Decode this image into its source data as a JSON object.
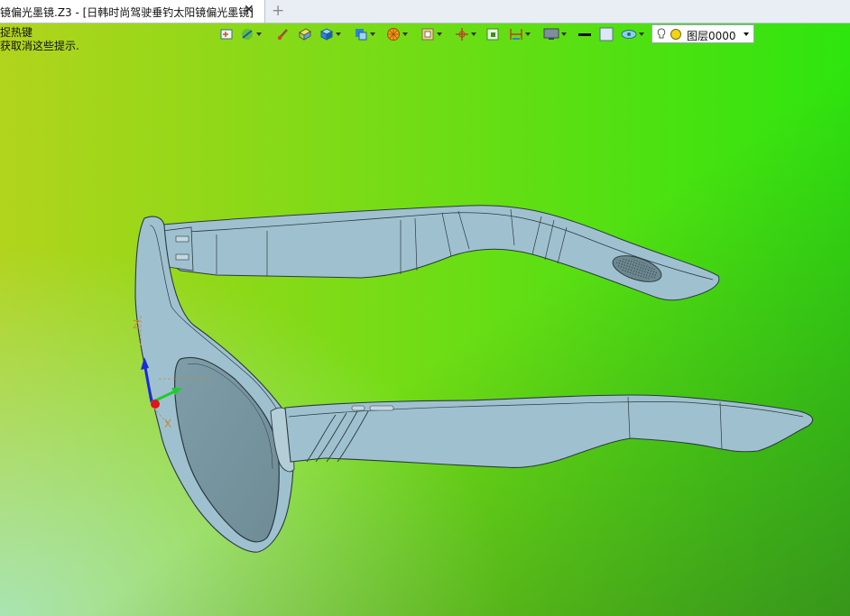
{
  "tab": {
    "title": "镜偏光墨镜.Z3 - [日韩时尚驾驶垂钓太阳镜偏光墨镜]",
    "close": "✕",
    "new": "+"
  },
  "hint": {
    "line1": "捉热键",
    "line2": "获取消这些提示."
  },
  "layer": {
    "selected": "图层0000"
  },
  "toolbar": {
    "icons": [
      "view-icon",
      "shading-icon",
      "brush-icon",
      "box-shade-icon",
      "cube-icon",
      "view-cube-icon",
      "color-wheel-icon",
      "frame-icon",
      "axis-icon",
      "window-icon",
      "measure-icon",
      "monitor-icon",
      "line-style-icon",
      "color-swatch-icon",
      "eye-layer-icon",
      "bulb-icon"
    ]
  },
  "viewport": {
    "background_colors": [
      "#a6e12a",
      "#3de013",
      "#9fe5b0",
      "#5a8a3a"
    ],
    "model_color": "#9fc1cf",
    "triad_labels": {
      "z": "Z",
      "x": "X"
    }
  }
}
